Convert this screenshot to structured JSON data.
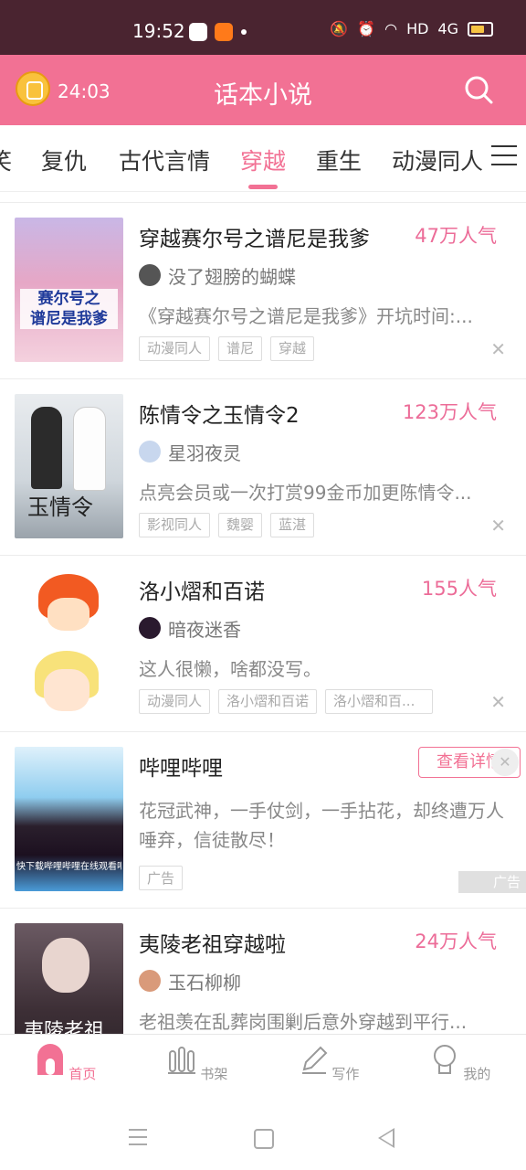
{
  "statusbar": {
    "time": "19:52",
    "network": "HD",
    "signal": "4G"
  },
  "header": {
    "timer": "24:03",
    "title": "话本小说"
  },
  "tabs": [
    {
      "label": "笑"
    },
    {
      "label": "复仇"
    },
    {
      "label": "古代言情"
    },
    {
      "label": "穿越",
      "active": true
    },
    {
      "label": "重生"
    },
    {
      "label": "动漫同人"
    }
  ],
  "books": [
    {
      "title": "穿越赛尔号之谱尼是我爹",
      "popularity": "47万人气",
      "author": "没了翅膀的蝴蝶",
      "description": "《穿越赛尔号之谱尼是我爹》开坑时间:...",
      "tags": [
        "动漫同人",
        "谱尼",
        "穿越"
      ],
      "cover_text": [
        "赛尔号之",
        "谱尼是我爹"
      ]
    },
    {
      "title": "陈情令之玉情令2",
      "popularity": "123万人气",
      "author": "星羽夜灵",
      "description": "点亮会员或一次打赏99金币加更陈情令...",
      "tags": [
        "影视同人",
        "魏婴",
        "蓝湛"
      ],
      "cover_text": [
        "玉情令"
      ]
    },
    {
      "title": "洛小熠和百诺",
      "popularity": "155人气",
      "author": "暗夜迷香",
      "description": "这人很懒，啥都没写。",
      "tags": [
        "动漫同人",
        "洛小熠和百诺",
        "洛小熠和百..."
      ]
    },
    {
      "title": "夷陵老祖穿越啦",
      "popularity": "24万人气",
      "author": "玉石柳柳",
      "description": "老祖羡在乱葬岗围剿后意外穿越到平行...",
      "tags": [],
      "cover_text": [
        "夷陵老祖"
      ]
    }
  ],
  "ad": {
    "title": "哔哩哔哩",
    "description": "花冠武神，一手仗剑，一手拈花，却终遭万人唾弃，信徒散尽！",
    "tag": "广告",
    "button": "查看详情",
    "ad_label": "广告",
    "banner_text": "快下载哔哩哔哩在线观看吧"
  },
  "bottom_nav": [
    {
      "label": "首页",
      "icon": "home-icon",
      "active": true
    },
    {
      "label": "书架",
      "icon": "bookshelf-icon"
    },
    {
      "label": "写作",
      "icon": "pen-icon"
    },
    {
      "label": "我的",
      "icon": "profile-icon"
    }
  ],
  "colors": {
    "accent": "#f27194",
    "status_bar": "#4a2430",
    "popularity": "#ec6c98"
  }
}
